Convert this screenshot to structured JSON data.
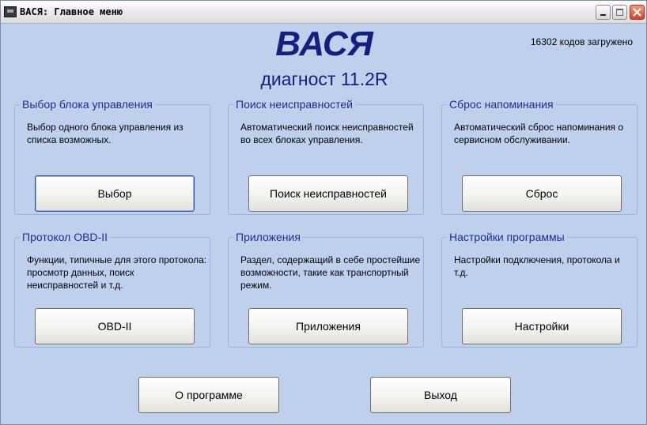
{
  "window": {
    "title": "ВАСЯ:  Главное меню",
    "icon": "app-icon"
  },
  "header": {
    "title": "ВАСЯ",
    "subtitle": "диагност 11.2R",
    "codes_status": "16302 кодов загружено"
  },
  "groups": [
    {
      "title": "Выбор блока управления",
      "description": "Выбор одного блока управления из списка возможных.",
      "button": "Выбор"
    },
    {
      "title": "Поиск неисправностей",
      "description": "Автоматический поиск неисправностей во всех блоках управления.",
      "button": "Поиск неисправностей"
    },
    {
      "title": "Сброс напоминания",
      "description": "Автоматический сброс напоминания о сервисном обслуживании.",
      "button": "Сброс"
    },
    {
      "title": "Протокол OBD-II",
      "description": "Функции, типичные для этого протокола: просмотр данных, поиск неисправностей и т.д.",
      "button": "OBD-II"
    },
    {
      "title": "Приложения",
      "description": "Раздел, содержащий в себе простейшие возможности, такие как транспортный режим.",
      "button": "Приложения"
    },
    {
      "title": "Настройки программы",
      "description": "Настройки подключения, протокола и т.д.",
      "button": "Настройки"
    }
  ],
  "footer": {
    "about_label": "О программе",
    "exit_label": "Выход"
  },
  "colors": {
    "background": "#bfd0ec",
    "title_blue": "#13207e",
    "group_title_blue": "#1a2e92",
    "close_red": "#d2462a"
  }
}
